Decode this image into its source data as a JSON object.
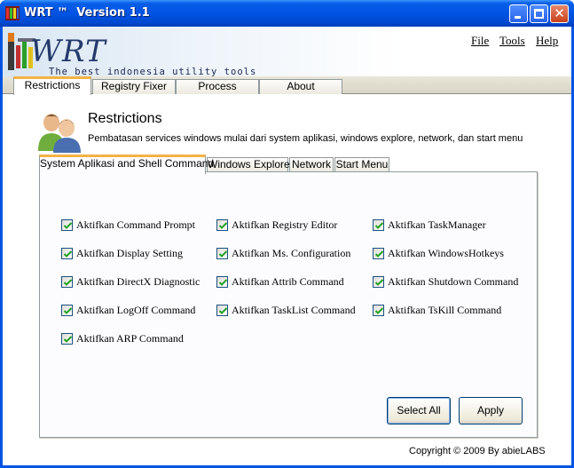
{
  "window": {
    "title": "WRT ™  Version 1.1"
  },
  "header": {
    "logo_text": "WRT",
    "tagline": "The best indonesia utility tools",
    "menu": {
      "file": "File",
      "tools": "Tools",
      "help": "Help"
    }
  },
  "main_tabs": [
    "Restrictions",
    "Registry Fixer",
    "Process Manager",
    "About"
  ],
  "panel": {
    "title": "Restrictions",
    "description": "Pembatasan services windows mulai dari system aplikasi, windows explore, network, dan start menu"
  },
  "sub_tabs": [
    "System Aplikasi  and Shell Command",
    "Windows Explore",
    "Network",
    "Start Menu"
  ],
  "checkboxes": [
    {
      "label": "Aktifkan Command Prompt",
      "checked": true
    },
    {
      "label": "Aktifkan Registry Editor",
      "checked": true
    },
    {
      "label": "Aktifkan TaskManager",
      "checked": true
    },
    {
      "label": "Aktifkan Display Setting",
      "checked": true
    },
    {
      "label": "Aktifkan Ms. Configuration",
      "checked": true
    },
    {
      "label": "Aktifkan WindowsHotkeys",
      "checked": true
    },
    {
      "label": "Aktifkan DirectX Diagnostic",
      "checked": true
    },
    {
      "label": "Aktifkan Attrib Command",
      "checked": true
    },
    {
      "label": "Aktifkan Shutdown Command",
      "checked": true
    },
    {
      "label": "Aktifkan LogOff Command",
      "checked": true
    },
    {
      "label": "Aktifkan TaskList Command",
      "checked": true
    },
    {
      "label": "Aktifkan TsKill Command",
      "checked": true
    },
    {
      "label": "Aktifkan ARP Command",
      "checked": true
    }
  ],
  "buttons": {
    "select_all": "Select All",
    "apply": "Apply"
  },
  "footer": {
    "copyright": "Copyright © 2009 By abieLABS"
  },
  "colors": {
    "titlebar": "#0054e3",
    "tab_highlight": "#f4b342",
    "checkmark": "#21a121"
  }
}
